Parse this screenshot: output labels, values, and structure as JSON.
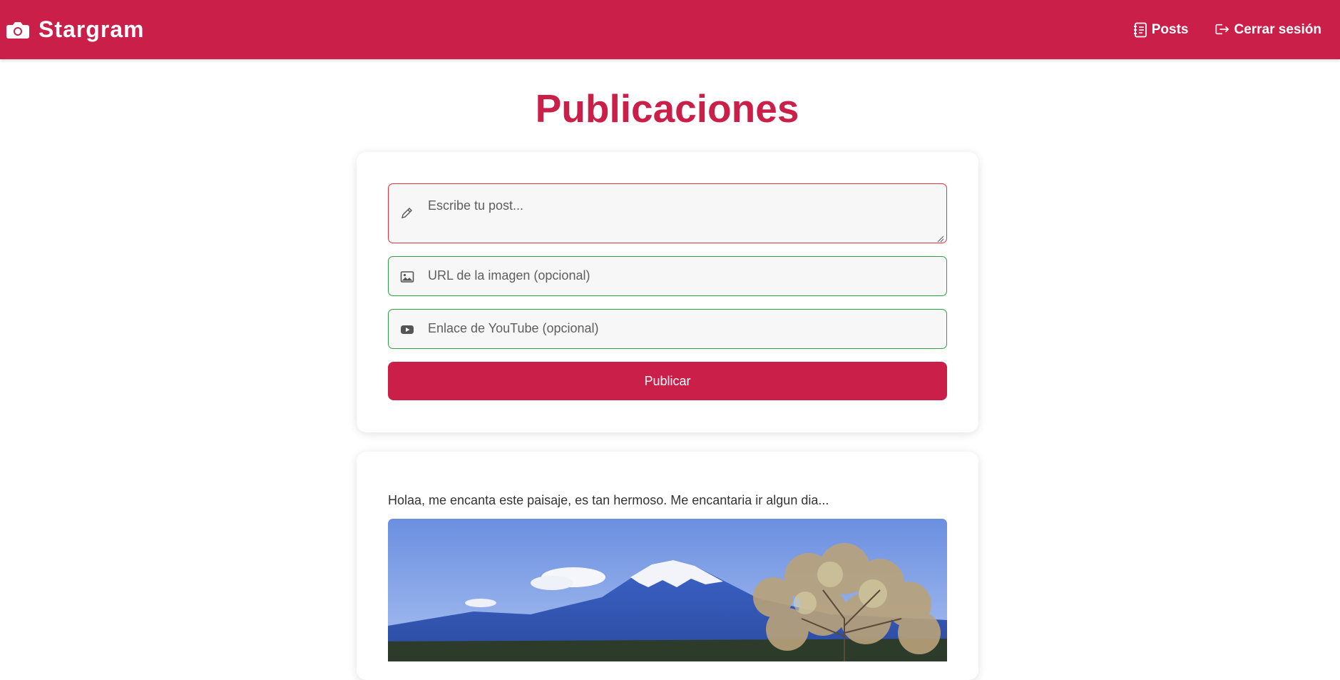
{
  "app": {
    "brand": "Stargram",
    "brand_icon": "camera-icon"
  },
  "nav": {
    "posts_label": "Posts",
    "posts_icon": "journal-icon",
    "logout_label": "Cerrar sesión",
    "logout_icon": "logout-icon"
  },
  "page": {
    "title": "Publicaciones"
  },
  "form": {
    "post_placeholder": "Escribe tu post...",
    "post_icon": "pencil-icon",
    "image_placeholder": "URL de la imagen (opcional)",
    "image_icon": "image-icon",
    "youtube_placeholder": "Enlace de YouTube (opcional)",
    "youtube_icon": "youtube-icon",
    "submit_label": "Publicar"
  },
  "posts": [
    {
      "text": "Holaa, me encanta este paisaje, es tan hermoso. Me encantaria ir algun dia...",
      "image": "mountain-landscape-photo"
    }
  ],
  "colors": {
    "brand": "#c91f48",
    "error_border": "#e0333f",
    "valid_border": "#2ea043",
    "field_bg": "#f7f7f7"
  }
}
